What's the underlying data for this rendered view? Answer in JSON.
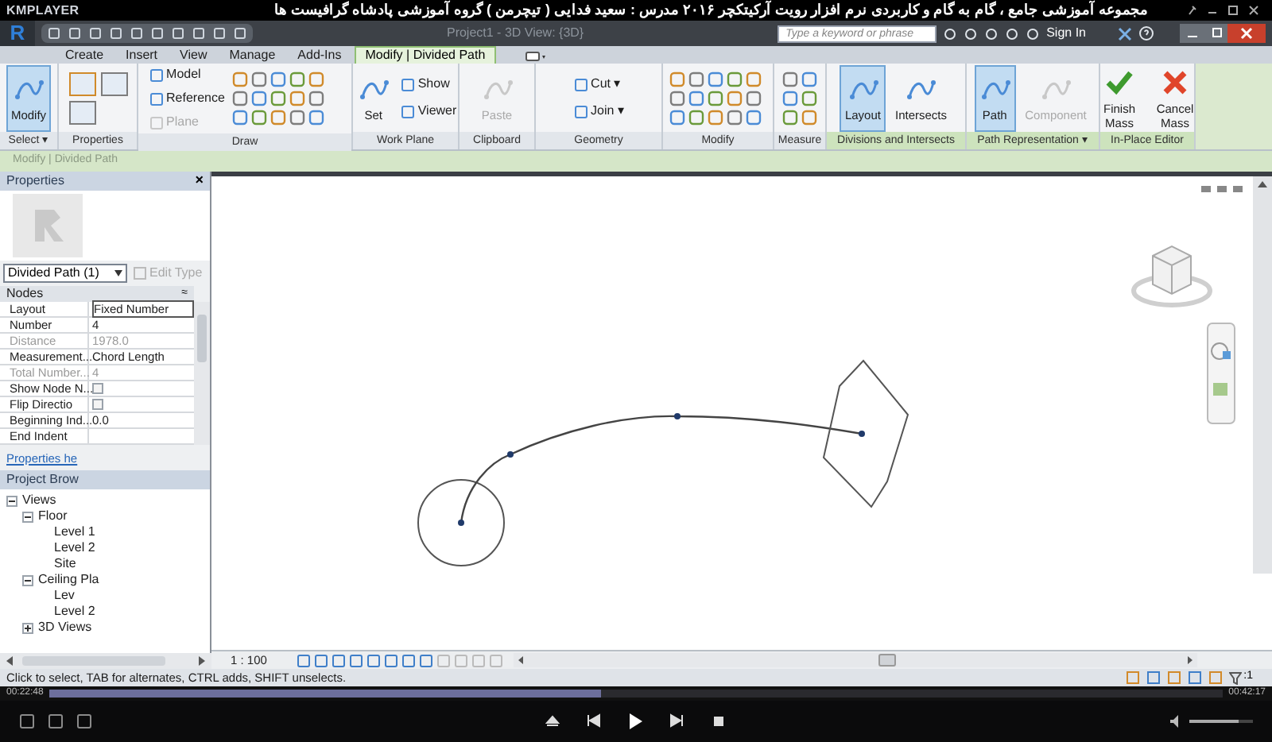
{
  "player": {
    "logo": "KMPLAYER",
    "title": "مجموعه آموزشی جامع ، گام به گام و کاربردی نرم افزار رویت آرکیتکچر ۲۰۱۶   مدرس : سعید فدایی ( تیچرمن ) گروه آموزشی پادشاه گرافیست ها",
    "elapsed": "00:22:48",
    "total": "00:42:17",
    "progress": {
      "level": 0.47
    },
    "volume": {
      "level": 0.78
    }
  },
  "app": {
    "logo": "R",
    "document_title": "Project1 - 3D View: {3D}",
    "search": {
      "placeholder": "Type a keyword or phrase"
    },
    "sign_in": "Sign In"
  },
  "tabs": [
    {
      "label": "Create",
      "selected": false
    },
    {
      "label": "Insert",
      "selected": false
    },
    {
      "label": "View",
      "selected": false
    },
    {
      "label": "Manage",
      "selected": false
    },
    {
      "label": "Add-Ins",
      "selected": false
    },
    {
      "label": "Modify | Divided Path",
      "selected": true
    }
  ],
  "ribbon": [
    {
      "label": "Select ▾",
      "kind": "tools",
      "contextual": false,
      "tools": [
        {
          "label": "Modify",
          "kind": "large",
          "selected": true,
          "disabled": false
        }
      ]
    },
    {
      "label": "Properties",
      "kind": "grid",
      "contextual": false
    },
    {
      "label": "Draw",
      "kind": "draw",
      "contextual": false,
      "tools": [
        {
          "label": "Model",
          "kind": "small",
          "selected": false,
          "disabled": false
        },
        {
          "label": "Reference",
          "kind": "small",
          "selected": false,
          "disabled": false
        },
        {
          "label": "Plane",
          "kind": "small",
          "selected": false,
          "disabled": true
        }
      ]
    },
    {
      "label": "Work Plane",
      "kind": "tools",
      "contextual": false,
      "tools": [
        {
          "label": "Set",
          "kind": "large",
          "selected": false,
          "disabled": false
        },
        {
          "label": "Show",
          "kind": "small",
          "selected": false,
          "disabled": false
        },
        {
          "label": "Viewer",
          "kind": "small",
          "selected": false,
          "disabled": false
        }
      ]
    },
    {
      "label": "Clipboard",
      "kind": "tools",
      "contextual": false,
      "tools": [
        {
          "label": "Paste",
          "kind": "large",
          "selected": false,
          "disabled": true
        }
      ]
    },
    {
      "label": "Geometry",
      "kind": "tools",
      "contextual": false,
      "tools": [
        {
          "label": "Cut ▾",
          "kind": "small",
          "selected": false,
          "disabled": false
        },
        {
          "label": "Join ▾",
          "kind": "small",
          "selected": false,
          "disabled": false
        }
      ]
    },
    {
      "label": "Modify",
      "kind": "grid",
      "contextual": false
    },
    {
      "label": "Measure",
      "kind": "grid",
      "contextual": false
    },
    {
      "label": "Divisions and Intersects",
      "kind": "tools",
      "contextual": true,
      "tools": [
        {
          "label": "Layout",
          "kind": "large",
          "selected": true,
          "disabled": false
        },
        {
          "label": "Intersects",
          "kind": "large",
          "selected": false,
          "disabled": false
        }
      ]
    },
    {
      "label": "Path Representation ▾",
      "kind": "tools",
      "contextual": true,
      "tools": [
        {
          "label": "Path",
          "kind": "large",
          "selected": true,
          "disabled": false
        },
        {
          "label": "Component",
          "kind": "large",
          "selected": false,
          "disabled": true
        }
      ]
    },
    {
      "label": "In-Place Editor",
      "kind": "tools",
      "contextual": true,
      "tools": [
        {
          "label": "Finish Mass",
          "kind": "finish",
          "selected": false,
          "disabled": false
        },
        {
          "label": "Cancel Mass",
          "kind": "cancel",
          "selected": false,
          "disabled": false
        }
      ]
    }
  ],
  "options_bar": "Modify | Divided Path",
  "properties": {
    "title": "Properties",
    "close": "×",
    "type_selector": "Divided Path (1)",
    "edit_type": {
      "label": "Edit Type",
      "disabled": true
    },
    "group": "Nodes",
    "collapse": "≈",
    "rows": [
      {
        "label": "Layout",
        "value": "Fixed Number",
        "kind": "text",
        "disabled": false
      },
      {
        "label": "Number",
        "value": "4",
        "kind": "text",
        "disabled": false
      },
      {
        "label": "Distance",
        "value": "1978.0",
        "kind": "text",
        "disabled": true
      },
      {
        "label": "Measurement...",
        "value": "Chord Length",
        "kind": "text",
        "disabled": false
      },
      {
        "label": "Total Number...",
        "value": "4",
        "kind": "text",
        "disabled": true
      },
      {
        "label": "Show Node N...",
        "kind": "checkbox",
        "checked": false,
        "disabled": false
      },
      {
        "label": "Flip Directio",
        "kind": "checkbox",
        "checked": false,
        "disabled": false
      },
      {
        "label": "Beginning Ind...",
        "value": "0.0",
        "kind": "text",
        "disabled": false
      },
      {
        "label": "End Indent",
        "kind": "text",
        "disabled": false
      }
    ],
    "help_link": "Properties he"
  },
  "project_browser": {
    "title": "Project Brow",
    "tree": [
      {
        "label": "Views",
        "expanded": true,
        "children": [
          {
            "label": "Floor",
            "expanded": true,
            "children": [
              {
                "label": "Level 1"
              },
              {
                "label": "Level 2"
              },
              {
                "label": "Site"
              }
            ]
          },
          {
            "label": "Ceiling Pla",
            "expanded": true,
            "children": [
              {
                "label": "Lev"
              },
              {
                "label": "Level 2"
              }
            ]
          },
          {
            "label": "3D Views",
            "expanded": false
          }
        ]
      }
    ]
  },
  "view_bar": {
    "scale": "1 : 100"
  },
  "status_bar": "Click to select, TAB for alternates, CTRL adds, SHIFT unselects.",
  "status_filter": ":1"
}
